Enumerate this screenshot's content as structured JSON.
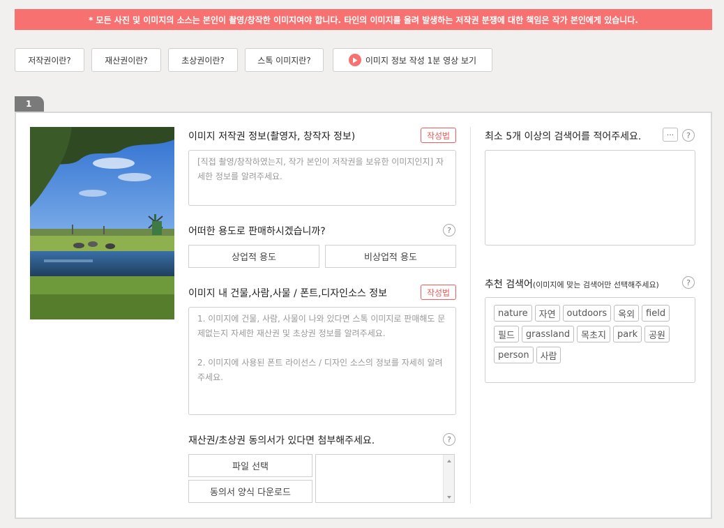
{
  "banner": {
    "text": "* 모든 사진 및 이미지의 소스는 본인이 촬영/창작한 이미지여야 합니다. 타인의 이미지를 올려 발생하는 저작권 분쟁에 대한 책임은 작가 본인에게 있습니다."
  },
  "help_buttons": [
    "저작권이란?",
    "재산권이란?",
    "초상권이란?",
    "스톡 이미지란?"
  ],
  "video_button": {
    "label": "이미지 정보 작성 1분 영상 보기"
  },
  "item_number": "1",
  "copyright": {
    "label": "이미지 저작권 정보(촬영자, 창작자 정보)",
    "guide": "작성법",
    "placeholder": "[직접 촬영/창작하였는지, 작가 본인이 저작권을 보유한 이미지인지] 자세한 정보를 알려주세요."
  },
  "usage": {
    "label": "어떠한 용도로 판매하시겠습니까?",
    "help": "?",
    "options": [
      "상업적 용도",
      "비상업적 용도"
    ]
  },
  "rights": {
    "label": "이미지 내 건물,사람,사물 / 폰트,디자인소스 정보",
    "guide": "작성법",
    "placeholder_1": "1. 이미지에 건물, 사람, 사물이 나와 있다면 스톡 이미지로 판매해도 문제없는지 자세한 재산권 및 초상권 정보를 알려주세요.",
    "placeholder_2": "2. 이미지에 사용된 폰트 라이선스 / 디자인 소스의 정보를 자세히 알려주세요."
  },
  "consent": {
    "label": "재산권/초상권 동의서가 있다면 첨부해주세요.",
    "help": "?",
    "file_button": "파일 선택",
    "download_button": "동의서 양식 다운로드"
  },
  "keywords": {
    "label": "최소 5개 이상의 검색어를 적어주세요.",
    "more": "···",
    "help": "?"
  },
  "recommended": {
    "label": "추천 검색어",
    "sublabel": "(이미지에 맞는 검색어만 선택해주세요)",
    "help": "?",
    "tags": [
      "nature",
      "자연",
      "outdoors",
      "옥외",
      "field",
      "필드",
      "grassland",
      "목초지",
      "park",
      "공원",
      "person",
      "사람"
    ]
  }
}
